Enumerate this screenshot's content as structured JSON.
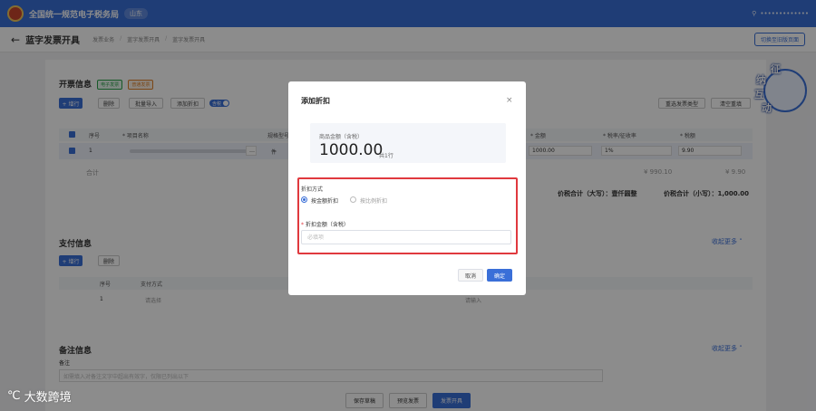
{
  "header": {
    "system_title": "全国统一规范电子税务局",
    "region": "山东",
    "user": "•••••••••••••"
  },
  "breadcrumb": {
    "page_title": "蓝字发票开具",
    "items": [
      "发票业务",
      "蓝字发票开具",
      "蓝字发票开具"
    ],
    "switch_label": "切换至旧版页面"
  },
  "invoice_info": {
    "title": "开票信息",
    "tag_green": "电子发票",
    "tag_orange": "普通发票",
    "buttons": {
      "add_row": "+ 增行",
      "delete": "删除",
      "batch_import": "批量导入",
      "add_discount": "添加折扣",
      "toggle": "含税"
    },
    "right_buttons": {
      "select_type": "重选发票类型",
      "clear": "清空重填"
    },
    "columns": {
      "seq": "序号",
      "project_name": "* 项目名称",
      "spec": "规格型号",
      "amount": "* 金额",
      "tax_rate": "* 税率/征收率",
      "tax": "* 税额"
    },
    "row": {
      "seq": "1",
      "unit_short": "件",
      "amount": "1000.00",
      "tax_rate": "1%",
      "tax": "9.90"
    },
    "totals": {
      "label": "合计",
      "amount_total": "¥ 990.10",
      "tax_total": "¥ 9.90",
      "price_tax_upper": "价税合计（大写）：壹仟圆整",
      "price_tax_lower": "价税合计（小写）：1,000.00"
    }
  },
  "payment_info": {
    "title": "支付信息",
    "add_row": "+ 增行",
    "delete": "删除",
    "columns": {
      "seq": "序号",
      "payment_method": "支付方式"
    },
    "row": {
      "seq": "1",
      "method": "请选择",
      "amount": "请输入"
    },
    "collapse": "收起更多 ˄"
  },
  "remarks": {
    "title": "备注信息",
    "label": "备注",
    "placeholder": "如需填入对备注文字中超出有效字，仅限已列出以下"
  },
  "footer": {
    "save_draft": "保存草稿",
    "preview": "预览发票",
    "issue": "发票开具"
  },
  "mascot": {
    "chars": [
      "征",
      "纳",
      "互",
      "动"
    ]
  },
  "watermark": {
    "text": "大数跨境"
  },
  "modal": {
    "title": "添加折扣",
    "close": "×",
    "amount_label": "商品金额（含税）",
    "amount_value": "1000.00",
    "row_count": "共1行",
    "discount_method_label": "折扣方式",
    "options": [
      "按金额折扣",
      "按比例折扣"
    ],
    "selected_option": 0,
    "discount_amount_label": "折扣金额（含税）",
    "required_mark": "*",
    "input_placeholder": "必填项",
    "cancel": "取消",
    "confirm": "确定"
  }
}
